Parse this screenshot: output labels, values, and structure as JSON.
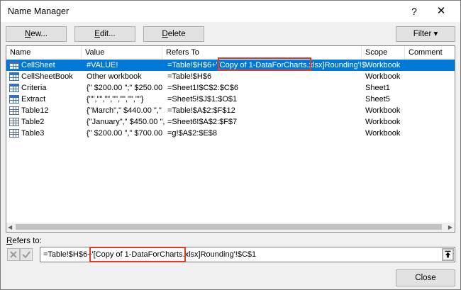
{
  "window": {
    "title": "Name Manager",
    "help_glyph": "?",
    "close_glyph": "✕"
  },
  "toolbar": {
    "new_pre": "",
    "new_ul": "N",
    "new_post": "ew...",
    "edit_ul": "E",
    "edit_post": "dit...",
    "delete_ul": "D",
    "delete_post": "elete",
    "filter_label": "Filter",
    "filter_arrow": "▾"
  },
  "columns": [
    "Name",
    "Value",
    "Refers To",
    "Scope",
    "Comment"
  ],
  "rows": [
    {
      "icon": "table-icon",
      "name": "CellSheet",
      "value": "#VALUE!",
      "refers_to": "=Table!$H$6+'[Copy of 1-DataForCharts.xlsx]Rounding'!$C$1",
      "scope": "Workbook",
      "comment": "",
      "selected": true
    },
    {
      "icon": "table-icon",
      "name": "CellSheetBook",
      "value": "Other workbook",
      "refers_to": "=Table!$H$6",
      "scope": "Workbook",
      "comment": ""
    },
    {
      "icon": "table-icon",
      "name": "Criteria",
      "value": "{\" $200.00 \";\" $250.00 ...",
      "refers_to": "=Sheet1!$C$2:$C$6",
      "scope": "Sheet1",
      "comment": ""
    },
    {
      "icon": "table-icon",
      "name": "Extract",
      "value": "{\"\",\"\",\"\",\"\",\"\",\"\",\"\"}",
      "refers_to": "=Sheet5!$J$1:$O$1",
      "scope": "Sheet5",
      "comment": ""
    },
    {
      "icon": "grid-icon",
      "name": "Table12",
      "value": "{\"March\",\" $440.00 \",\" ...",
      "refers_to": "=Table!$A$2:$F$12",
      "scope": "Workbook",
      "comment": ""
    },
    {
      "icon": "grid-icon",
      "name": "Table2",
      "value": "{\"January\",\" $450.00 \",...",
      "refers_to": "=Sheet6!$A$2:$F$7",
      "scope": "Workbook",
      "comment": ""
    },
    {
      "icon": "grid-icon",
      "name": "Table3",
      "value": "{\" $200.00 \",\" $700.00 ...",
      "refers_to": "=g!$A$2:$E$8",
      "scope": "Workbook",
      "comment": ""
    }
  ],
  "refers_to": {
    "label_ul": "R",
    "label_post": "efers to:",
    "value": "=Table!$H$6+'[Copy of 1-DataForCharts.xlsx]Rounding'!$C$1",
    "cancel_glyph": "✕",
    "ok_glyph": "✓",
    "collapse_glyph": "⭱"
  },
  "close_label": "Close",
  "colors": {
    "selection": "#0078d7",
    "highlight_box": "#e23a2a"
  }
}
